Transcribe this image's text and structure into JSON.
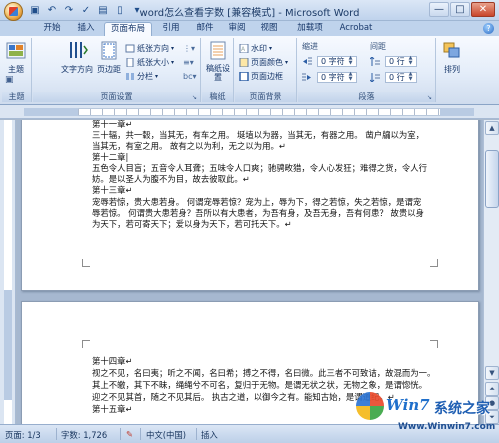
{
  "window": {
    "title": "word怎么查看字数 [兼容模式] - Microsoft Word",
    "qat_icons": [
      "save-icon",
      "undo-icon",
      "redo-icon",
      "check-icon",
      "print-preview-icon",
      "new-doc-icon",
      "customize-icon"
    ],
    "controls": [
      "—",
      "□",
      "✕"
    ]
  },
  "tabs": [
    {
      "label": "开始",
      "active": false
    },
    {
      "label": "插入",
      "active": false
    },
    {
      "label": "页面布局",
      "active": true
    },
    {
      "label": "引用",
      "active": false
    },
    {
      "label": "邮件",
      "active": false
    },
    {
      "label": "审阅",
      "active": false
    },
    {
      "label": "视图",
      "active": false
    },
    {
      "label": "加载项",
      "active": false
    },
    {
      "label": "Acrobat",
      "active": false
    }
  ],
  "ribbon": {
    "theme": {
      "label": "主题",
      "group": "主题",
      "icon": "themes-icon"
    },
    "page_setup": {
      "group": "页面设置",
      "text_direction": "文字方向",
      "margins": "页边距",
      "orientation": "纸张方向",
      "size": "纸张大小",
      "columns": "分栏"
    },
    "draft": {
      "group": "稿纸",
      "label": "稿纸设置"
    },
    "page_bg": {
      "group": "页面背景",
      "watermark": "水印",
      "page_color": "页面颜色",
      "page_border": "页面边框"
    },
    "paragraph": {
      "group": "段落",
      "indent_label": "缩进",
      "spacing_label": "间距",
      "left_value": "0 字符",
      "right_value": "0 字符",
      "before_value": "0 行",
      "after_value": "0 行"
    },
    "arrange": {
      "label": "排列"
    }
  },
  "document": {
    "page1_lines": [
      {
        "text": "第十一章↵",
        "cls": "mark-head"
      },
      {
        "text": "三十辐，共一毂，当其无，有车之用。 埏埴以为器，当其无，有器之用。 凿户牖以为室，",
        "cls": ""
      },
      {
        "text": "当其无，有室之用。 故有之以为利，无之以为用。↵",
        "cls": ""
      },
      {
        "text": "第十二章|",
        "cls": ""
      },
      {
        "text": "五色令人目盲；五音令人耳聋；五味令人口爽；驰骋畋猎，令人心发狂；难得之货，令人行",
        "cls": ""
      },
      {
        "text": "妨。是以圣人为腹不为目，故去彼取此。↵",
        "cls": ""
      },
      {
        "text": "第十三章↵",
        "cls": ""
      },
      {
        "text": "宠辱若惊，贵大患若身。 何谓宠辱若惊？宠为上，辱为下，得之若惊，失之若惊，是谓宠",
        "cls": ""
      },
      {
        "text": "辱若惊。 何谓贵大患若身？吾所以有大患者，为吾有身，及吾无身，吾有何患？ 故贵以身",
        "cls": ""
      },
      {
        "text": "为天下，若可寄天下；爱以身为天下，若可托天下。↵",
        "cls": ""
      }
    ],
    "page2_lines": [
      {
        "text": "第十四章↵",
        "cls": ""
      },
      {
        "text": "视之不见，名曰夷；听之不闻，名曰希；搏之不得，名曰微。此三者不可致诘，故混而为一。",
        "cls": ""
      },
      {
        "text": "其上不皦，其下不昧，绳绳兮不可名，复归于无物。是谓无状之状，无物之象，是谓惚恍。",
        "cls": ""
      },
      {
        "text": "迎之不见其首，随之不见其后。 执古之道，以御今之有。能知古始，是谓道纪。↵",
        "cls": ""
      },
      {
        "text": "第十五章↵",
        "cls": ""
      }
    ]
  },
  "status": {
    "page": "页面: 1/3",
    "words": "字数: 1,726",
    "lang": "中文(中国)",
    "mode": "插入"
  },
  "watermark": {
    "brand_a": "Win7",
    "brand_b": "系统之家",
    "url": "Www.Winwin7.com"
  }
}
